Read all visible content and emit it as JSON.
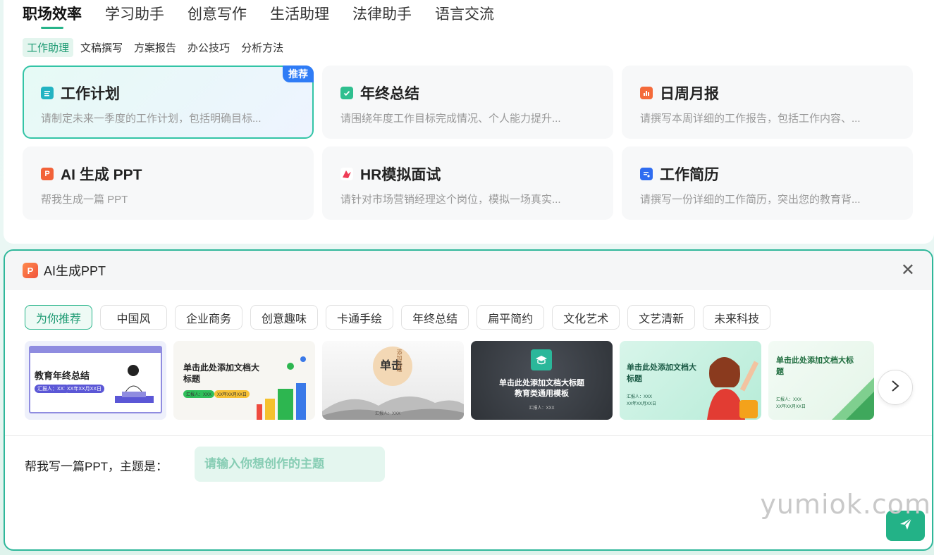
{
  "top_tabs": [
    "职场效率",
    "学习助手",
    "创意写作",
    "生活助理",
    "法律助手",
    "语言交流"
  ],
  "sub_tabs": [
    "工作助理",
    "文稿撰写",
    "方案报告",
    "办公技巧",
    "分析方法"
  ],
  "cards": [
    {
      "title": "工作计划",
      "desc": "请制定未来一季度的工作计划，包括明确目标...",
      "badge": "推荐",
      "icon": "clipboard-icon",
      "color": "#22b3c2"
    },
    {
      "title": "年终总结",
      "desc": "请围绕年度工作目标完成情况、个人能力提升...",
      "icon": "check-document-icon",
      "color": "#2fbf8f"
    },
    {
      "title": "日周月报",
      "desc": "请撰写本周详细的工作报告，包括工作内容、...",
      "icon": "bar-chart-icon",
      "color": "#f46a3a"
    },
    {
      "title": "AI 生成 PPT",
      "desc": "帮我生成一篇 PPT",
      "icon": "ppt-icon",
      "color": "#f26239"
    },
    {
      "title": "HR模拟面试",
      "desc": "请针对市场营销经理这个岗位，模拟一场真实...",
      "icon": "interview-icon",
      "color": "#ef3b55"
    },
    {
      "title": "工作简历",
      "desc": "请撰写一份详细的工作简历，突出您的教育背...",
      "icon": "resume-icon",
      "color": "#2f6cf0"
    }
  ],
  "ppt_panel": {
    "title": "AI生成PPT",
    "icon": "ppt-icon",
    "chips": [
      "为你推荐",
      "中国风",
      "企业商务",
      "创意趣味",
      "卡通手绘",
      "年终总结",
      "扁平简约",
      "文化艺术",
      "文艺清新",
      "未来科技"
    ],
    "templates": [
      {
        "name": "template-year-end",
        "title": "教育年终总结",
        "subtitle": "汇报人：XXX",
        "date": "XX年XX月XX日"
      },
      {
        "name": "template-business",
        "title": "单击此处添加文档大标题",
        "subtitle": "汇报人：XXX",
        "date": "XX年XX月XX日"
      },
      {
        "name": "template-chinese",
        "title": "单击",
        "subtitle": "添加标题",
        "date": "汇报人：XXX"
      },
      {
        "name": "template-education",
        "title": "单击此处添加文档大标题",
        "subtitle": "教育类通用模板",
        "date": "汇报人：XXX"
      },
      {
        "name": "template-cartoon",
        "title": "单击此处添加文档大标题",
        "subtitle": "汇报人：XXX",
        "date": "XX年XX月XX日"
      },
      {
        "name": "template-fresh",
        "title": "单击此处添加文档大标题",
        "subtitle": "汇报人：XXX",
        "date": "XX年XX月XX日"
      }
    ],
    "prompt_label": "帮我写一篇PPT，主题是：",
    "prompt_placeholder": "请输入你想创作的主题"
  },
  "watermark": "yumiok.com"
}
